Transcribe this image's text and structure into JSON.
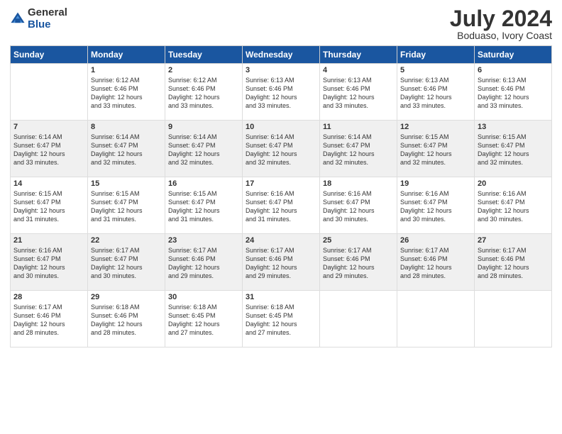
{
  "logo": {
    "general": "General",
    "blue": "Blue"
  },
  "title": {
    "month": "July 2024",
    "location": "Boduaso, Ivory Coast"
  },
  "days_of_week": [
    "Sunday",
    "Monday",
    "Tuesday",
    "Wednesday",
    "Thursday",
    "Friday",
    "Saturday"
  ],
  "weeks": [
    [
      {
        "day": "",
        "info": ""
      },
      {
        "day": "1",
        "info": "Sunrise: 6:12 AM\nSunset: 6:46 PM\nDaylight: 12 hours\nand 33 minutes."
      },
      {
        "day": "2",
        "info": "Sunrise: 6:12 AM\nSunset: 6:46 PM\nDaylight: 12 hours\nand 33 minutes."
      },
      {
        "day": "3",
        "info": "Sunrise: 6:13 AM\nSunset: 6:46 PM\nDaylight: 12 hours\nand 33 minutes."
      },
      {
        "day": "4",
        "info": "Sunrise: 6:13 AM\nSunset: 6:46 PM\nDaylight: 12 hours\nand 33 minutes."
      },
      {
        "day": "5",
        "info": "Sunrise: 6:13 AM\nSunset: 6:46 PM\nDaylight: 12 hours\nand 33 minutes."
      },
      {
        "day": "6",
        "info": "Sunrise: 6:13 AM\nSunset: 6:46 PM\nDaylight: 12 hours\nand 33 minutes."
      }
    ],
    [
      {
        "day": "7",
        "info": "Sunrise: 6:14 AM\nSunset: 6:47 PM\nDaylight: 12 hours\nand 33 minutes."
      },
      {
        "day": "8",
        "info": "Sunrise: 6:14 AM\nSunset: 6:47 PM\nDaylight: 12 hours\nand 32 minutes."
      },
      {
        "day": "9",
        "info": "Sunrise: 6:14 AM\nSunset: 6:47 PM\nDaylight: 12 hours\nand 32 minutes."
      },
      {
        "day": "10",
        "info": "Sunrise: 6:14 AM\nSunset: 6:47 PM\nDaylight: 12 hours\nand 32 minutes."
      },
      {
        "day": "11",
        "info": "Sunrise: 6:14 AM\nSunset: 6:47 PM\nDaylight: 12 hours\nand 32 minutes."
      },
      {
        "day": "12",
        "info": "Sunrise: 6:15 AM\nSunset: 6:47 PM\nDaylight: 12 hours\nand 32 minutes."
      },
      {
        "day": "13",
        "info": "Sunrise: 6:15 AM\nSunset: 6:47 PM\nDaylight: 12 hours\nand 32 minutes."
      }
    ],
    [
      {
        "day": "14",
        "info": "Sunrise: 6:15 AM\nSunset: 6:47 PM\nDaylight: 12 hours\nand 31 minutes."
      },
      {
        "day": "15",
        "info": "Sunrise: 6:15 AM\nSunset: 6:47 PM\nDaylight: 12 hours\nand 31 minutes."
      },
      {
        "day": "16",
        "info": "Sunrise: 6:15 AM\nSunset: 6:47 PM\nDaylight: 12 hours\nand 31 minutes."
      },
      {
        "day": "17",
        "info": "Sunrise: 6:16 AM\nSunset: 6:47 PM\nDaylight: 12 hours\nand 31 minutes."
      },
      {
        "day": "18",
        "info": "Sunrise: 6:16 AM\nSunset: 6:47 PM\nDaylight: 12 hours\nand 30 minutes."
      },
      {
        "day": "19",
        "info": "Sunrise: 6:16 AM\nSunset: 6:47 PM\nDaylight: 12 hours\nand 30 minutes."
      },
      {
        "day": "20",
        "info": "Sunrise: 6:16 AM\nSunset: 6:47 PM\nDaylight: 12 hours\nand 30 minutes."
      }
    ],
    [
      {
        "day": "21",
        "info": "Sunrise: 6:16 AM\nSunset: 6:47 PM\nDaylight: 12 hours\nand 30 minutes."
      },
      {
        "day": "22",
        "info": "Sunrise: 6:17 AM\nSunset: 6:47 PM\nDaylight: 12 hours\nand 30 minutes."
      },
      {
        "day": "23",
        "info": "Sunrise: 6:17 AM\nSunset: 6:46 PM\nDaylight: 12 hours\nand 29 minutes."
      },
      {
        "day": "24",
        "info": "Sunrise: 6:17 AM\nSunset: 6:46 PM\nDaylight: 12 hours\nand 29 minutes."
      },
      {
        "day": "25",
        "info": "Sunrise: 6:17 AM\nSunset: 6:46 PM\nDaylight: 12 hours\nand 29 minutes."
      },
      {
        "day": "26",
        "info": "Sunrise: 6:17 AM\nSunset: 6:46 PM\nDaylight: 12 hours\nand 28 minutes."
      },
      {
        "day": "27",
        "info": "Sunrise: 6:17 AM\nSunset: 6:46 PM\nDaylight: 12 hours\nand 28 minutes."
      }
    ],
    [
      {
        "day": "28",
        "info": "Sunrise: 6:17 AM\nSunset: 6:46 PM\nDaylight: 12 hours\nand 28 minutes."
      },
      {
        "day": "29",
        "info": "Sunrise: 6:18 AM\nSunset: 6:46 PM\nDaylight: 12 hours\nand 28 minutes."
      },
      {
        "day": "30",
        "info": "Sunrise: 6:18 AM\nSunset: 6:45 PM\nDaylight: 12 hours\nand 27 minutes."
      },
      {
        "day": "31",
        "info": "Sunrise: 6:18 AM\nSunset: 6:45 PM\nDaylight: 12 hours\nand 27 minutes."
      },
      {
        "day": "",
        "info": ""
      },
      {
        "day": "",
        "info": ""
      },
      {
        "day": "",
        "info": ""
      }
    ]
  ]
}
